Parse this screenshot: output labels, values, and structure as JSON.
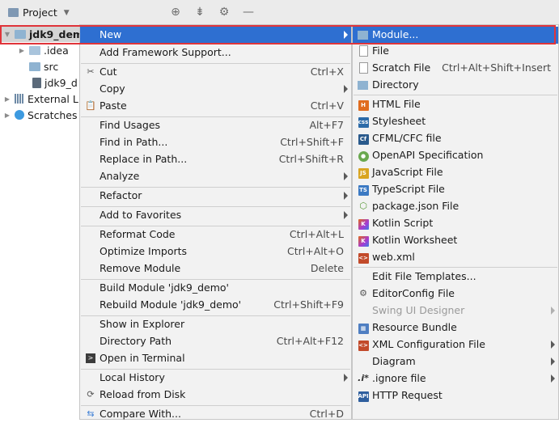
{
  "project_panel": {
    "title": "Project",
    "tools": [
      "locate-icon",
      "collapse-icon",
      "gear-icon",
      "hide-icon"
    ],
    "tree": [
      {
        "label": "jdk9_dem",
        "icon": "module-folder-icon"
      },
      {
        "label": ".idea",
        "icon": "folder-icon"
      },
      {
        "label": "src",
        "icon": "folder-icon"
      },
      {
        "label": "jdk9_d",
        "icon": "iml-file-icon"
      },
      {
        "label": "External L",
        "icon": "library-icon"
      },
      {
        "label": "Scratches",
        "icon": "scratch-icon"
      }
    ]
  },
  "context_menu": {
    "new": "New",
    "add_framework": "Add Framework Support...",
    "cut": "Cut",
    "cut_sc": "Ctrl+X",
    "copy": "Copy",
    "paste": "Paste",
    "paste_sc": "Ctrl+V",
    "find_usages": "Find Usages",
    "find_usages_sc": "Alt+F7",
    "find_in_path": "Find in Path...",
    "find_in_path_sc": "Ctrl+Shift+F",
    "replace_in_path": "Replace in Path...",
    "replace_in_path_sc": "Ctrl+Shift+R",
    "analyze": "Analyze",
    "refactor": "Refactor",
    "add_favorites": "Add to Favorites",
    "reformat": "Reformat Code",
    "reformat_sc": "Ctrl+Alt+L",
    "optimize": "Optimize Imports",
    "optimize_sc": "Ctrl+Alt+O",
    "remove_module": "Remove Module",
    "remove_module_sc": "Delete",
    "build_module": "Build Module 'jdk9_demo'",
    "rebuild_module": "Rebuild Module 'jdk9_demo'",
    "rebuild_module_sc": "Ctrl+Shift+F9",
    "show_explorer": "Show in Explorer",
    "directory_path": "Directory Path",
    "directory_path_sc": "Ctrl+Alt+F12",
    "open_terminal": "Open in Terminal",
    "local_history": "Local History",
    "reload": "Reload from Disk",
    "compare": "Compare With...",
    "compare_sc": "Ctrl+D"
  },
  "new_submenu": {
    "module": "Module...",
    "file": "File",
    "scratch": "Scratch File",
    "scratch_sc": "Ctrl+Alt+Shift+Insert",
    "directory": "Directory",
    "html": "HTML File",
    "stylesheet": "Stylesheet",
    "cfml": "CFML/CFC file",
    "openapi": "OpenAPI Specification",
    "javascript": "JavaScript File",
    "typescript": "TypeScript File",
    "packagejson": "package.json File",
    "kotlin_script": "Kotlin Script",
    "kotlin_worksheet": "Kotlin Worksheet",
    "webxml": "web.xml",
    "edit_templates": "Edit File Templates...",
    "editorconfig": "EditorConfig File",
    "swing": "Swing UI Designer",
    "resource_bundle": "Resource Bundle",
    "xml_config": "XML Configuration File",
    "diagram": "Diagram",
    "ignore": ".ignore file",
    "http": "HTTP Request"
  },
  "colors": {
    "highlight": "#2e6fd1",
    "frame": "#e0343a"
  }
}
